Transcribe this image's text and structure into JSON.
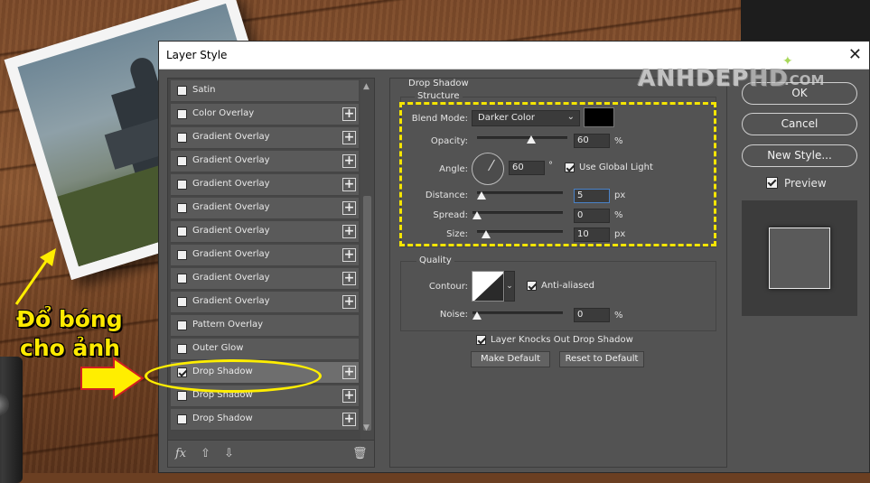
{
  "dialog": {
    "title": "Layer Style",
    "close_glyph": "✕"
  },
  "effects_list": {
    "items": [
      {
        "label": "Satin",
        "checked": false,
        "has_plus": false
      },
      {
        "label": "Color Overlay",
        "checked": false,
        "has_plus": true
      },
      {
        "label": "Gradient Overlay",
        "checked": false,
        "has_plus": true
      },
      {
        "label": "Gradient Overlay",
        "checked": false,
        "has_plus": true
      },
      {
        "label": "Gradient Overlay",
        "checked": false,
        "has_plus": true
      },
      {
        "label": "Gradient Overlay",
        "checked": false,
        "has_plus": true
      },
      {
        "label": "Gradient Overlay",
        "checked": false,
        "has_plus": true
      },
      {
        "label": "Gradient Overlay",
        "checked": false,
        "has_plus": true
      },
      {
        "label": "Gradient Overlay",
        "checked": false,
        "has_plus": true
      },
      {
        "label": "Gradient Overlay",
        "checked": false,
        "has_plus": true
      },
      {
        "label": "Pattern Overlay",
        "checked": false,
        "has_plus": false
      },
      {
        "label": "Outer Glow",
        "checked": false,
        "has_plus": false
      },
      {
        "label": "Drop Shadow",
        "checked": true,
        "has_plus": true,
        "selected": true
      },
      {
        "label": "Drop Shadow",
        "checked": false,
        "has_plus": true
      },
      {
        "label": "Drop Shadow",
        "checked": false,
        "has_plus": true
      }
    ],
    "toolbar": {
      "fx": "fx",
      "up": "⇧",
      "down": "⇩",
      "trash": "🗑"
    }
  },
  "drop_shadow": {
    "section_title": "Drop Shadow",
    "structure_title": "Structure",
    "blend_mode_label": "Blend Mode:",
    "blend_mode_value": "Darker Color",
    "shadow_color": "#000000",
    "opacity_label": "Opacity:",
    "opacity_value": "60",
    "opacity_unit": "%",
    "opacity_fraction": 0.6,
    "angle_label": "Angle:",
    "angle_value": "60",
    "angle_unit": "°",
    "use_global_light_label": "Use Global Light",
    "use_global_light_checked": true,
    "distance_label": "Distance:",
    "distance_value": "5",
    "distance_unit": "px",
    "spread_label": "Spread:",
    "spread_value": "0",
    "spread_unit": "%",
    "size_label": "Size:",
    "size_value": "10",
    "size_unit": "px",
    "quality_title": "Quality",
    "contour_label": "Contour:",
    "anti_aliased_label": "Anti-aliased",
    "anti_aliased_checked": true,
    "noise_label": "Noise:",
    "noise_value": "0",
    "noise_unit": "%",
    "knockout_label": "Layer Knocks Out Drop Shadow",
    "knockout_checked": true,
    "make_default_label": "Make Default",
    "reset_default_label": "Reset to Default"
  },
  "side_buttons": {
    "ok_label": "OK",
    "cancel_label": "Cancel",
    "new_style_label": "New Style...",
    "preview_label": "Preview",
    "preview_checked": true
  },
  "annotations": {
    "line1": "Đổ bóng",
    "line2": "cho ảnh",
    "highlight_color": "#ffee00"
  },
  "watermark": {
    "text_a": "ANHDEP",
    "text_b": "HD",
    "text_c": ".COM"
  }
}
